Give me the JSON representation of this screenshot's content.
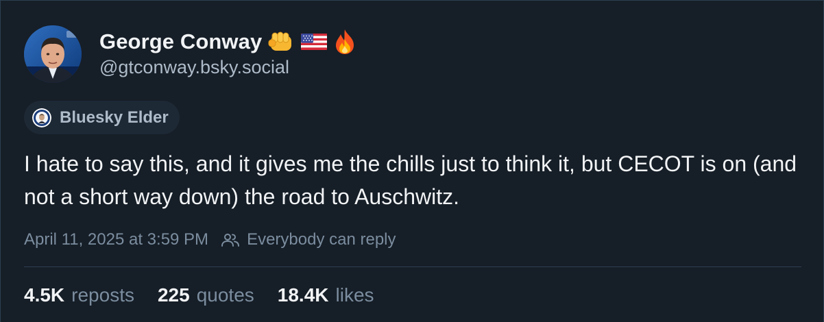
{
  "author": {
    "display_name": "George Conway",
    "emojis": [
      "oncoming-fist-emoji",
      "us-flag-emoji",
      "fire-emoji"
    ],
    "handle": "@gtconway.bsky.social",
    "avatar": "avatar-photo"
  },
  "badge": {
    "icon": "elder-badge-icon",
    "label": "Bluesky Elder"
  },
  "post": {
    "text": "I hate to say this, and it gives me the chills just to think it, but CECOT is on (and not a short way down) the road to Auschwitz."
  },
  "meta": {
    "timestamp": "April 11, 2025 at 3:59 PM",
    "reply_setting_icon": "people-icon",
    "reply_setting": "Everybody can reply"
  },
  "stats": {
    "reposts_count": "4.5K",
    "reposts_label": "reposts",
    "quotes_count": "225",
    "quotes_label": "quotes",
    "likes_count": "18.4K",
    "likes_label": "likes"
  },
  "colors": {
    "background": "#161e27",
    "text_primary": "#f1f3f5",
    "text_secondary": "#aebbc9",
    "text_muted": "#7b8d9f",
    "border": "#2e4052",
    "badge_bg": "#1e2936"
  }
}
